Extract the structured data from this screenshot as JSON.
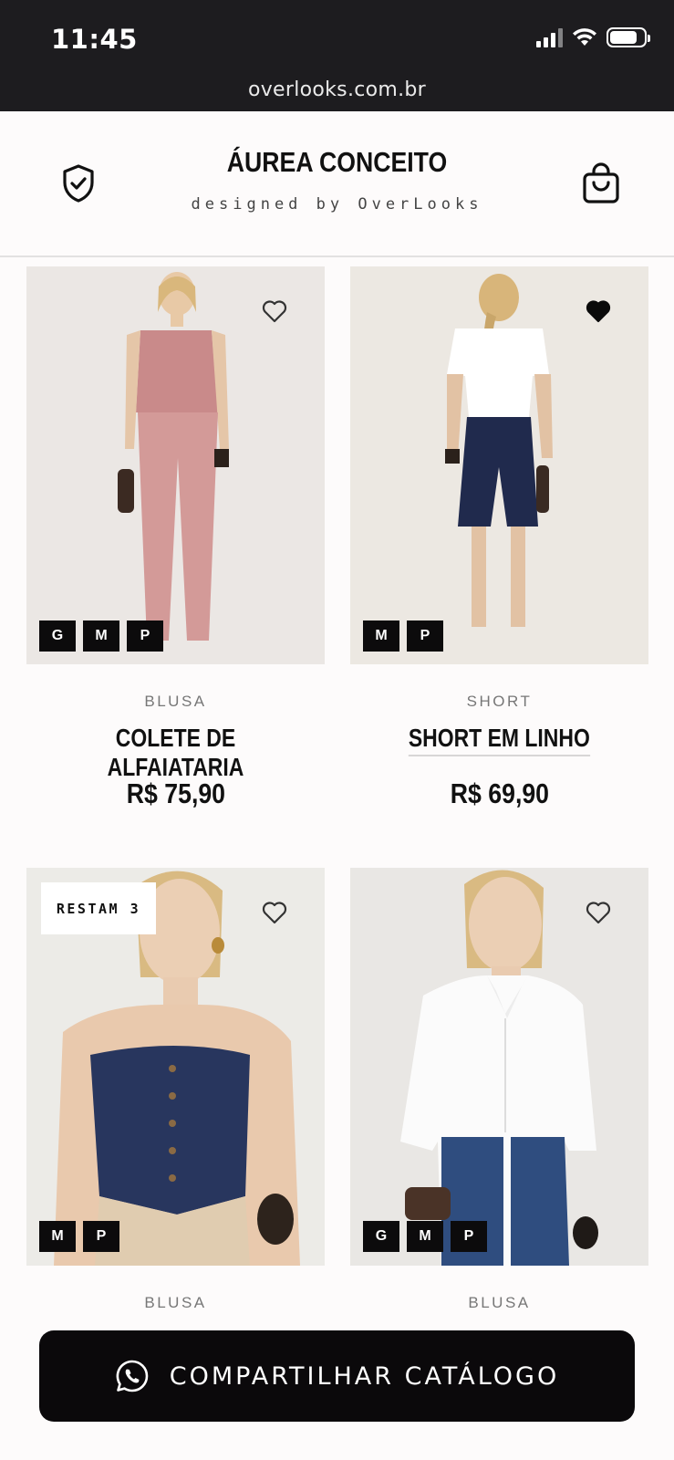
{
  "status_bar": {
    "time": "11:45",
    "url": "overlooks.com.br"
  },
  "header": {
    "title": "ÁUREA CONCEITO",
    "subtitle": "designed by OverLooks"
  },
  "products": [
    {
      "category": "BLUSA",
      "name": "COLETE DE ALFAIATARIA",
      "price": "R$ 75,90",
      "sizes": [
        "G",
        "M",
        "P"
      ],
      "favorited": false
    },
    {
      "category": "SHORT",
      "name": "SHORT EM LINHO",
      "price": "R$ 69,90",
      "sizes": [
        "M",
        "P"
      ],
      "favorited": true
    },
    {
      "category": "BLUSA",
      "stock_badge": "RESTAM 3",
      "sizes": [
        "M",
        "P"
      ],
      "favorited": false
    },
    {
      "category": "BLUSA",
      "sizes": [
        "G",
        "M",
        "P"
      ],
      "favorited": false
    }
  ],
  "share_button": {
    "label": "COMPARTILHAR CATÁLOGO"
  },
  "colors": {
    "dark": "#1d1c1f",
    "button": "#0b090b",
    "background": "#fdfbfb"
  }
}
